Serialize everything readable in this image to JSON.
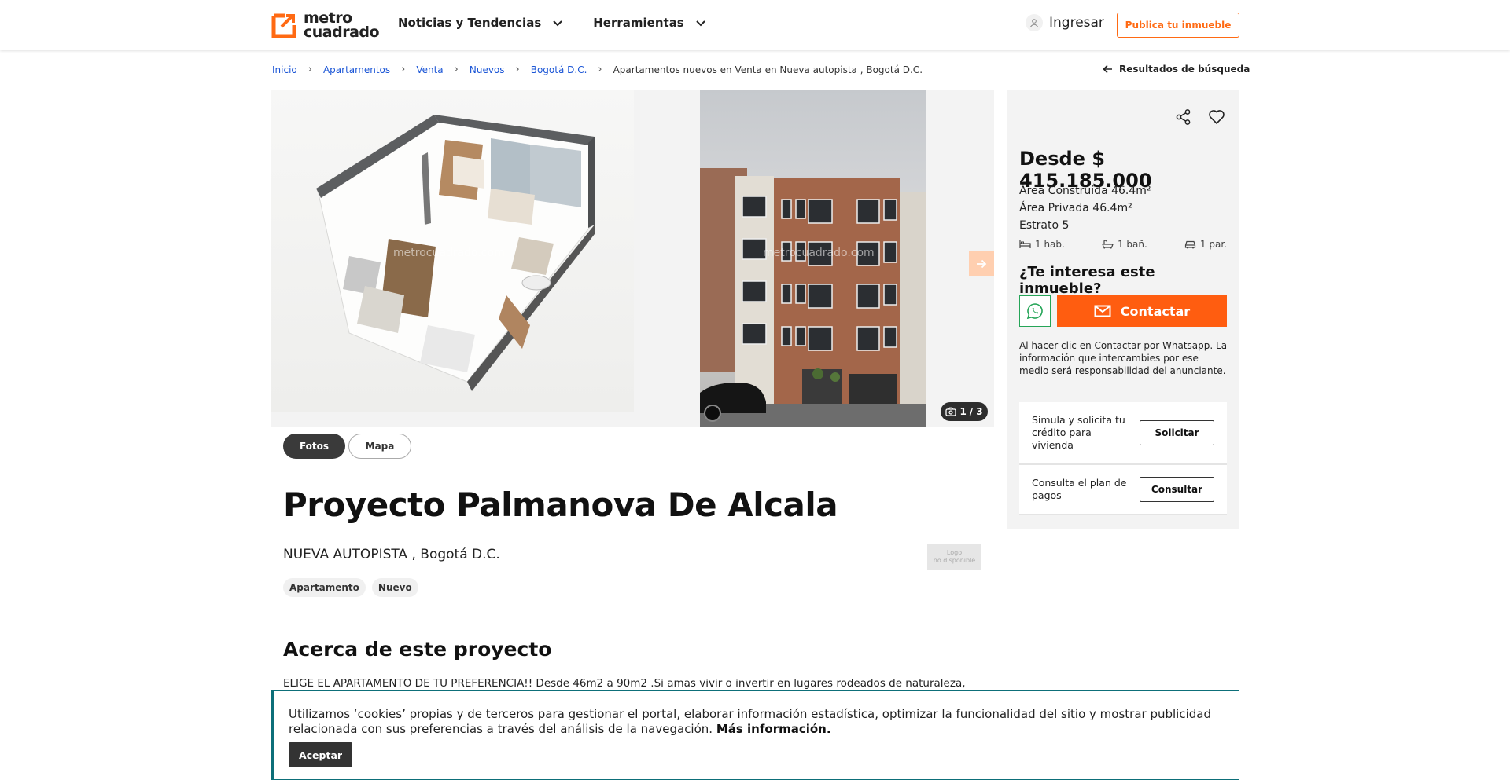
{
  "header": {
    "logo_line1": "metro",
    "logo_line2": "cuadrado",
    "nav": [
      "Noticias y Tendencias",
      "Herramientas"
    ],
    "login_label": "Ingresar",
    "publish_label": "Publica tu inmueble",
    "accent_color": "#ff6a13"
  },
  "breadcrumb": {
    "items": [
      "Inicio",
      "Apartamentos",
      "Venta",
      "Nuevos",
      "Bogotá D.C."
    ],
    "current": "Apartamentos nuevos en Venta en Nueva autopista , Bogotá D.C.",
    "back_label": "Resultados de búsqueda"
  },
  "gallery": {
    "watermark": "metrocuadrado.com",
    "counter_current": "1",
    "counter_sep": "/",
    "counter_total": "3",
    "tabs": [
      "Fotos",
      "Mapa"
    ]
  },
  "project": {
    "title": "Proyecto Palmanova De Alcala",
    "location": "NUEVA AUTOPISTA , Bogotá D.C.",
    "logo_placeholder_1": "Logo",
    "logo_placeholder_2": "no disponible",
    "tags": [
      "Apartamento",
      "Nuevo"
    ],
    "about_title": "Acerca de este proyecto",
    "about_text": "ELIGE EL APARTAMENTO DE TU PREFERENCIA!! Desde 46m2 a 90m2 .Si amas vivir o invertir en lugares rodeados de naturaleza,"
  },
  "sidebar": {
    "price": "Desde $ 415.185.000",
    "area_built": "Área Construida 46.4m²",
    "area_private": "Área Privada 46.4m²",
    "estrato": "Estrato 5",
    "features": [
      "1 hab.",
      "1 bañ.",
      "1 par."
    ],
    "interest_title": "¿Te interesa este inmueble?",
    "contact_label": "Contactar",
    "disclaimer": "Al hacer clic en Contactar por Whatsapp. La información que intercambies por ese medio será responsabilidad del anunciante.",
    "credit_text": "Simula y solicita tu crédito para vivienda",
    "credit_btn": "Solicitar",
    "plan_text": "Consulta el plan de pagos",
    "plan_btn": "Consultar",
    "whatsapp_color": "#25a558",
    "contact_color": "#ff5d10"
  },
  "cookie": {
    "text": "Utilizamos ‘cookies’ propias y de terceros para gestionar el portal, elaborar información estadística, optimizar la funcionalidad del sitio y mostrar publicidad relacionada con sus preferencias a través del análisis de la navegación.",
    "link": "Más información.",
    "accept": "Aceptar",
    "border_color": "#0d6f79"
  }
}
